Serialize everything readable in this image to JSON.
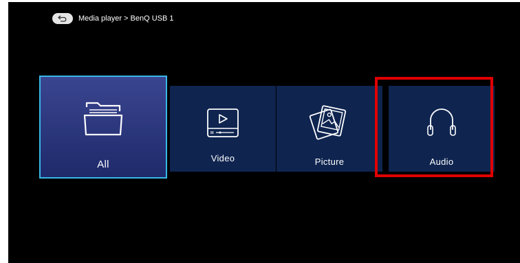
{
  "header": {
    "breadcrumb": "Media player > BenQ USB 1",
    "back_icon": "back-arrow-icon"
  },
  "tiles": [
    {
      "label": "All",
      "icon": "folder-icon",
      "selected": true
    },
    {
      "label": "Video",
      "icon": "video-player-icon",
      "selected": false
    },
    {
      "label": "Picture",
      "icon": "picture-stack-icon",
      "selected": false
    },
    {
      "label": "Audio",
      "icon": "headphones-icon",
      "selected": false
    }
  ],
  "colors": {
    "background": "#000000",
    "tile": "#0f2550",
    "selected_tile_top": "#3a4590",
    "selected_tile_bottom": "#1e2a6a",
    "focus_border": "#39b8e8",
    "annotation_box": "#e00000"
  }
}
